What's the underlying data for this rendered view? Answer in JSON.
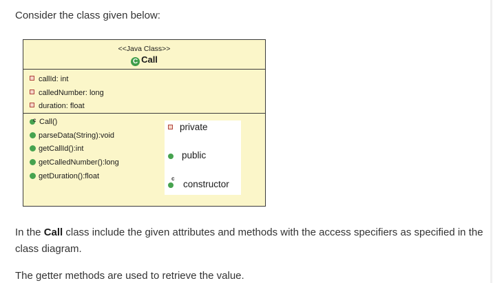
{
  "intro": "Consider the class given below:",
  "uml": {
    "stereotype": "<<Java Class>>",
    "class_icon": "C",
    "class_name": "Call",
    "attributes": [
      "callId: int",
      "calledNumber: long",
      "duration: float"
    ],
    "constructor": "Call()",
    "methods": [
      "parseData(String):void",
      "getCallId():int",
      "getCalledNumber():long",
      "getDuration():float"
    ],
    "colors": {
      "box_fill": "#fbf6c9",
      "public_green": "#46a34f",
      "private_red": "#b0433c"
    }
  },
  "legend": {
    "private": "private",
    "public": "public",
    "constructor": "constructor"
  },
  "paragraph1": {
    "before": "In the ",
    "bold": "Call",
    "after": " class include the given attributes and methods with the access specifiers as specified in the class diagram."
  },
  "paragraph2": "The getter methods are used to retrieve the value."
}
